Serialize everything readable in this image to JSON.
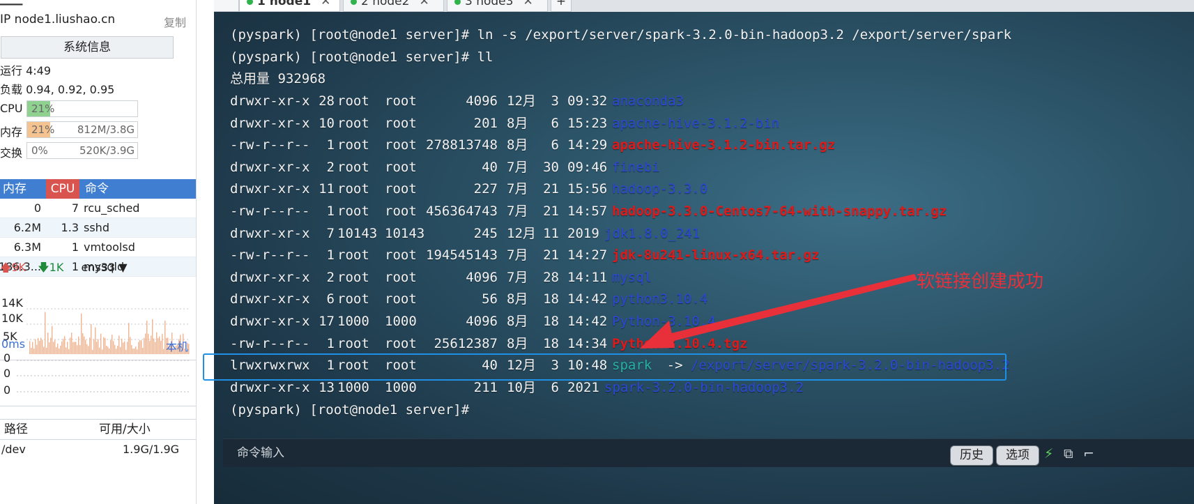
{
  "sidebar": {
    "host_line": "IP node1.liushao.cn",
    "copy_label": "复制",
    "sysinfo_button": "系统信息",
    "uptime": "运行 4:49",
    "load": "负载 0.94, 0.92, 0.95",
    "cpu": {
      "label": "CPU",
      "percent": "21%",
      "fraction": 0.21,
      "color": "#8fd18f"
    },
    "memory": {
      "label": "内存",
      "percent": "21%",
      "amount": "812M/3.8G",
      "fraction": 0.21,
      "color": "#f5c38f"
    },
    "swap": {
      "label": "交换",
      "percent": "0%",
      "amount": "520K/3.9G",
      "fraction": 0.0
    },
    "process_table": {
      "headers": [
        "内存",
        "CPU",
        "命令"
      ],
      "rows": [
        {
          "mem": "0",
          "cpu": "7",
          "cmd": "rcu_sched"
        },
        {
          "mem": "6.2M",
          "cpu": "1.3",
          "cmd": "sshd"
        },
        {
          "mem": "6.3M",
          "cpu": "1",
          "cmd": "vmtoolsd"
        },
        {
          "mem": "186.3...",
          "cpu": "1",
          "cmd": "mysqld"
        }
      ]
    },
    "network": {
      "up": "9K",
      "down": "1K",
      "interface": "ens33",
      "axis": [
        "14K",
        "10K",
        "5K"
      ]
    },
    "latency": {
      "label": "0ms",
      "target": "本机",
      "values": [
        "0",
        "0",
        "0"
      ]
    },
    "disk_table": {
      "headers": [
        "路径",
        "可用/大小"
      ],
      "rows": [
        {
          "path": "/dev",
          "size": "1.9G/1.9G"
        }
      ]
    }
  },
  "tabs": [
    {
      "label": "1 node1",
      "active": true
    },
    {
      "label": "2 node2",
      "active": false
    },
    {
      "label": "3 node3",
      "active": false
    }
  ],
  "terminal": {
    "prompt1": "(pyspark) [root@node1 server]# ln -s /export/server/spark-3.2.0-bin-hadoop3.2 /export/server/spark",
    "prompt2": "(pyspark) [root@node1 server]# ll",
    "total": "总用量 932968",
    "entries": [
      {
        "perm": "drwxr-xr-x",
        "links": "28",
        "user": "root",
        "group": "root",
        "size": "4096",
        "month": "12月",
        "day": "3",
        "time": "09:32",
        "name": "anaconda3",
        "kind": "dir"
      },
      {
        "perm": "drwxr-xr-x",
        "links": "10",
        "user": "root",
        "group": "root",
        "size": "201",
        "month": "8月",
        "day": "6",
        "time": "15:23",
        "name": "apache-hive-3.1.2-bin",
        "kind": "dir"
      },
      {
        "perm": "-rw-r--r--",
        "links": "1",
        "user": "root",
        "group": "root",
        "size": "278813748",
        "month": "8月",
        "day": "6",
        "time": "14:29",
        "name": "apache-hive-3.1.2-bin.tar.gz",
        "kind": "archive"
      },
      {
        "perm": "drwxr-xr-x",
        "links": "2",
        "user": "root",
        "group": "root",
        "size": "40",
        "month": "7月",
        "day": "30",
        "time": "09:46",
        "name": "finebi",
        "kind": "dir"
      },
      {
        "perm": "drwxr-xr-x",
        "links": "11",
        "user": "root",
        "group": "root",
        "size": "227",
        "month": "7月",
        "day": "21",
        "time": "15:56",
        "name": "hadoop-3.3.0",
        "kind": "dir"
      },
      {
        "perm": "-rw-r--r--",
        "links": "1",
        "user": "root",
        "group": "root",
        "size": "456364743",
        "month": "7月",
        "day": "21",
        "time": "14:57",
        "name": "hadoop-3.3.0-Centos7-64-with-snappy.tar.gz",
        "kind": "archive"
      },
      {
        "perm": "drwxr-xr-x",
        "links": "7",
        "user": "10143",
        "group": "10143",
        "size": "245",
        "month": "12月",
        "day": "11",
        "time": "2019",
        "name": "jdk1.8.0_241",
        "kind": "dir"
      },
      {
        "perm": "-rw-r--r--",
        "links": "1",
        "user": "root",
        "group": "root",
        "size": "194545143",
        "month": "7月",
        "day": "21",
        "time": "14:27",
        "name": "jdk-8u241-linux-x64.tar.gz",
        "kind": "archive"
      },
      {
        "perm": "drwxr-xr-x",
        "links": "2",
        "user": "root",
        "group": "root",
        "size": "4096",
        "month": "7月",
        "day": "28",
        "time": "14:11",
        "name": "mysql",
        "kind": "dir"
      },
      {
        "perm": "drwxr-xr-x",
        "links": "6",
        "user": "root",
        "group": "root",
        "size": "56",
        "month": "8月",
        "day": "18",
        "time": "14:42",
        "name": "python3.10.4",
        "kind": "dir"
      },
      {
        "perm": "drwxr-xr-x",
        "links": "17",
        "user": "1000",
        "group": "1000",
        "size": "4096",
        "month": "8月",
        "day": "18",
        "time": "14:42",
        "name": "Python-3.10.4",
        "kind": "dir"
      },
      {
        "perm": "-rw-r--r--",
        "links": "1",
        "user": "root",
        "group": "root",
        "size": "25612387",
        "month": "8月",
        "day": "18",
        "time": "14:34",
        "name": "Python-3.10.4.tgz",
        "kind": "archive"
      },
      {
        "perm": "lrwxrwxrwx",
        "links": "1",
        "user": "root",
        "group": "root",
        "size": "40",
        "month": "12月",
        "day": "3",
        "time": "10:48",
        "name": "spark",
        "kind": "link",
        "target": "/export/server/spark-3.2.0-bin-hadoop3.2"
      },
      {
        "perm": "drwxr-xr-x",
        "links": "13",
        "user": "1000",
        "group": "1000",
        "size": "211",
        "month": "10月",
        "day": "6",
        "time": "2021",
        "name": "spark-3.2.0-bin-hadoop3.2",
        "kind": "dir"
      }
    ],
    "prompt3": "(pyspark) [root@node1 server]#",
    "link_arrow": "->",
    "annotation": "软链接创建成功"
  },
  "command_bar": {
    "placeholder": "命令输入",
    "history_button": "历史",
    "options_button": "选项"
  }
}
